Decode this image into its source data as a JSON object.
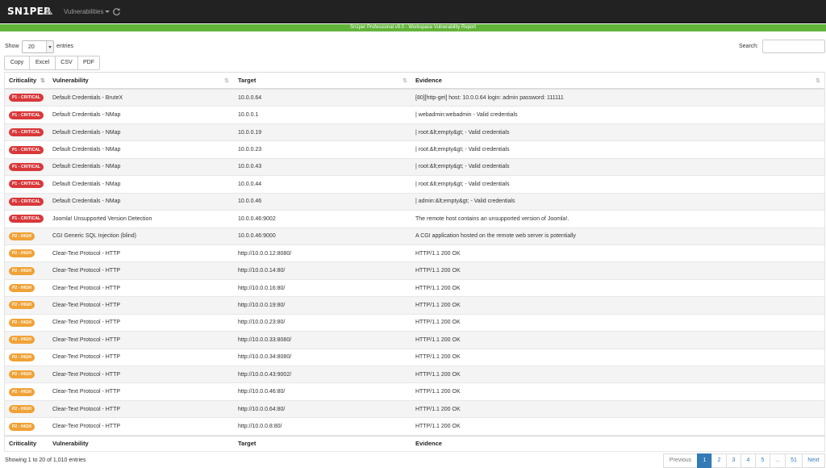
{
  "navbar": {
    "brand": "SN1PER",
    "menu_label": "Vulnerabilities",
    "brand_mark_icon": "triangle-logo-icon",
    "refresh_icon": "refresh-icon"
  },
  "banner": {
    "text": "Sn1per Professional v9.0 - Workspace Vulnerability Report"
  },
  "length": {
    "show_label": "Show",
    "value": "20",
    "entries_label": "entries"
  },
  "search": {
    "label": "Search:",
    "placeholder": ""
  },
  "buttons": [
    "Copy",
    "Excel",
    "CSV",
    "PDF"
  ],
  "columns": [
    "Criticality",
    "Vulnerability",
    "Target",
    "Evidence"
  ],
  "colors": {
    "critical": "#d9383a",
    "high": "#f0a236",
    "banner": "#62b33a",
    "accent": "#337ab7"
  },
  "rows": [
    {
      "crit": "P1 - CRITICAL",
      "level": "critical",
      "vuln": "Default Credentials - BruteX",
      "target": "10.0.0.64",
      "evidence": "[80][http-get] host: 10.0.0.64 login: admin password: 111111"
    },
    {
      "crit": "P1 - CRITICAL",
      "level": "critical",
      "vuln": "Default Credentials - NMap",
      "target": "10.0.0.1",
      "evidence": "| webadmin:webadmin - Valid credentials"
    },
    {
      "crit": "P1 - CRITICAL",
      "level": "critical",
      "vuln": "Default Credentials - NMap",
      "target": "10.0.0.19",
      "evidence": "| root:&lt;empty&gt; - Valid credentials"
    },
    {
      "crit": "P1 - CRITICAL",
      "level": "critical",
      "vuln": "Default Credentials - NMap",
      "target": "10.0.0.23",
      "evidence": "| root:&lt;empty&gt; - Valid credentials"
    },
    {
      "crit": "P1 - CRITICAL",
      "level": "critical",
      "vuln": "Default Credentials - NMap",
      "target": "10.0.0.43",
      "evidence": "| root:&lt;empty&gt; - Valid credentials"
    },
    {
      "crit": "P1 - CRITICAL",
      "level": "critical",
      "vuln": "Default Credentials - NMap",
      "target": "10.0.0.44",
      "evidence": "| root:&lt;empty&gt; - Valid credentials"
    },
    {
      "crit": "P1 - CRITICAL",
      "level": "critical",
      "vuln": "Default Credentials - NMap",
      "target": "10.0.0.46",
      "evidence": "| admin:&lt;empty&gt; - Valid credentials"
    },
    {
      "crit": "P1 - CRITICAL",
      "level": "critical",
      "vuln": "Joomla! Unsupported Version Detection",
      "target": "10.0.0.46:9002",
      "evidence": "The remote host contains an unsupported version of Joomla!."
    },
    {
      "crit": "P2 - HIGH",
      "level": "high",
      "vuln": "CGI Generic SQL Injection (blind)",
      "target": "10.0.0.46:9000",
      "evidence": "A CGI application hosted on the remote web server is potentially"
    },
    {
      "crit": "P2 - HIGH",
      "level": "high",
      "vuln": "Clear-Text Protocol - HTTP",
      "target": "http://10.0.0.12:8080/",
      "evidence": "HTTP/1.1 200 OK"
    },
    {
      "crit": "P2 - HIGH",
      "level": "high",
      "vuln": "Clear-Text Protocol - HTTP",
      "target": "http://10.0.0.14:80/",
      "evidence": "HTTP/1.1 200 OK"
    },
    {
      "crit": "P2 - HIGH",
      "level": "high",
      "vuln": "Clear-Text Protocol - HTTP",
      "target": "http://10.0.0.16:80/",
      "evidence": "HTTP/1.1 200 OK"
    },
    {
      "crit": "P2 - HIGH",
      "level": "high",
      "vuln": "Clear-Text Protocol - HTTP",
      "target": "http://10.0.0.19:80/",
      "evidence": "HTTP/1.1 200 OK"
    },
    {
      "crit": "P2 - HIGH",
      "level": "high",
      "vuln": "Clear-Text Protocol - HTTP",
      "target": "http://10.0.0.23:80/",
      "evidence": "HTTP/1.1 200 OK"
    },
    {
      "crit": "P2 - HIGH",
      "level": "high",
      "vuln": "Clear-Text Protocol - HTTP",
      "target": "http://10.0.0.33:8080/",
      "evidence": "HTTP/1.1 200 OK"
    },
    {
      "crit": "P2 - HIGH",
      "level": "high",
      "vuln": "Clear-Text Protocol - HTTP",
      "target": "http://10.0.0.34:8080/",
      "evidence": "HTTP/1.1 200 OK"
    },
    {
      "crit": "P2 - HIGH",
      "level": "high",
      "vuln": "Clear-Text Protocol - HTTP",
      "target": "http://10.0.0.43:9002/",
      "evidence": "HTTP/1.1 200 OK"
    },
    {
      "crit": "P2 - HIGH",
      "level": "high",
      "vuln": "Clear-Text Protocol - HTTP",
      "target": "http://10.0.0.46:80/",
      "evidence": "HTTP/1.1 200 OK"
    },
    {
      "crit": "P2 - HIGH",
      "level": "high",
      "vuln": "Clear-Text Protocol - HTTP",
      "target": "http://10.0.0.64:80/",
      "evidence": "HTTP/1.1 200 OK"
    },
    {
      "crit": "P2 - HIGH",
      "level": "high",
      "vuln": "Clear-Text Protocol - HTTP",
      "target": "http://10.0.0.8:80/",
      "evidence": "HTTP/1.1 200 OK"
    }
  ],
  "info": "Showing 1 to 20 of 1,010 entries",
  "pagination": {
    "previous": "Previous",
    "pages": [
      "1",
      "2",
      "3",
      "4",
      "5",
      "...",
      "51"
    ],
    "active": "1",
    "next": "Next"
  }
}
